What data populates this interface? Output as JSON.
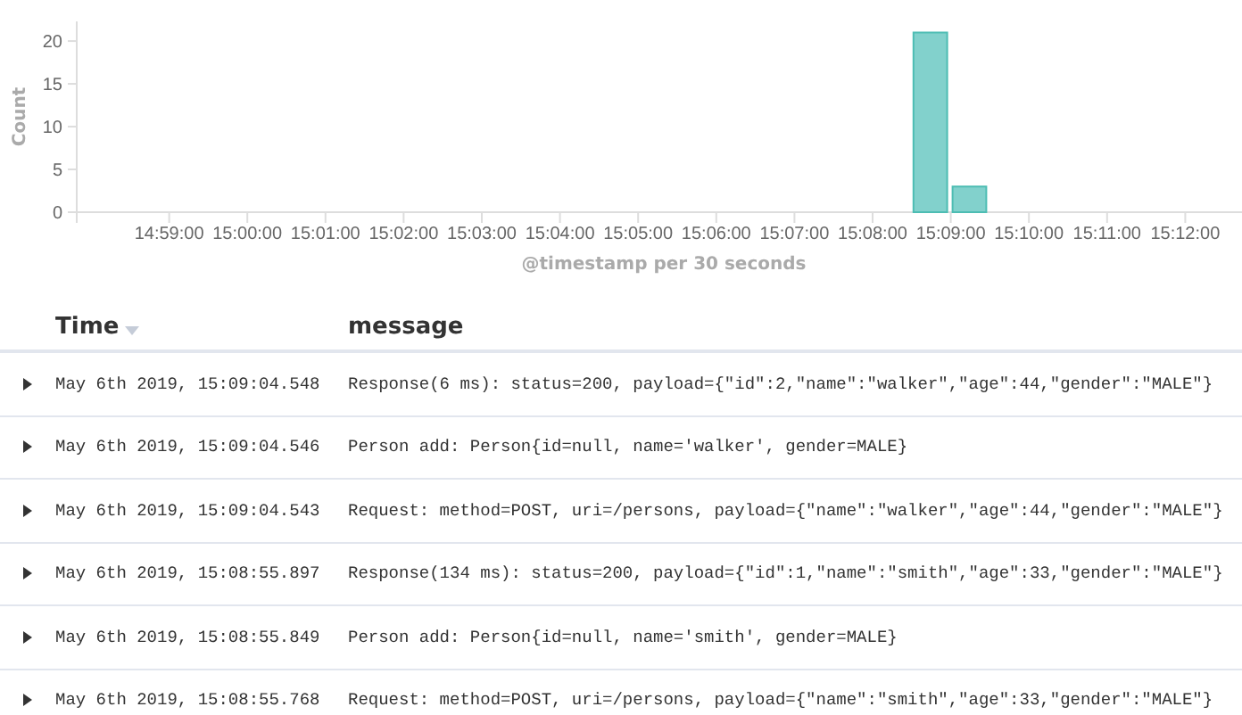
{
  "chart": {
    "chart_data": {
      "type": "bar",
      "xlabel": "@timestamp per 30 seconds",
      "ylabel": "Count",
      "categories": [
        null,
        null,
        "14:59:00",
        null,
        "15:00:00",
        null,
        "15:01:00",
        null,
        "15:02:00",
        null,
        "15:03:00",
        null,
        "15:04:00",
        null,
        "15:05:00",
        null,
        "15:06:00",
        null,
        "15:07:00",
        null,
        "15:08:00",
        null,
        "15:09:00",
        null,
        "15:10:00",
        null,
        "15:11:00",
        null,
        "15:12:00"
      ],
      "values": [
        0,
        0,
        0,
        0,
        0,
        0,
        0,
        0,
        0,
        0,
        0,
        0,
        0,
        0,
        0,
        0,
        0,
        0,
        0,
        0,
        0,
        21,
        3,
        0,
        0,
        0,
        0,
        0,
        0
      ],
      "ylim": [
        0,
        22.3
      ],
      "yticks": [
        0,
        5,
        10,
        15,
        20
      ]
    }
  },
  "table": {
    "columns": [
      "Time",
      "message"
    ],
    "rows": [
      {
        "expanded": false,
        "time": "May 6th 2019, 15:09:04.548",
        "message": "Response(6 ms): status=200, payload={\"id\":2,\"name\":\"walker\",\"age\":44,\"gender\":\"MALE\"}"
      },
      {
        "expanded": false,
        "time": "May 6th 2019, 15:09:04.546",
        "message": "Person add: Person{id=null, name='walker', gender=MALE}"
      },
      {
        "expanded": false,
        "time": "May 6th 2019, 15:09:04.543",
        "message": "Request: method=POST, uri=/persons, payload={\"name\":\"walker\",\"age\":44,\"gender\":\"MALE\"}"
      },
      {
        "expanded": false,
        "time": "May 6th 2019, 15:08:55.897",
        "message": "Response(134 ms): status=200, payload={\"id\":1,\"name\":\"smith\",\"age\":33,\"gender\":\"MALE\"}"
      },
      {
        "expanded": false,
        "time": "May 6th 2019, 15:08:55.849",
        "message": "Person add: Person{id=null, name='smith', gender=MALE}"
      },
      {
        "expanded": false,
        "time": "May 6th 2019, 15:08:55.768",
        "message": "Request: method=POST, uri=/persons, payload={\"name\":\"smith\",\"age\":33,\"gender\":\"MALE\"}"
      }
    ]
  }
}
